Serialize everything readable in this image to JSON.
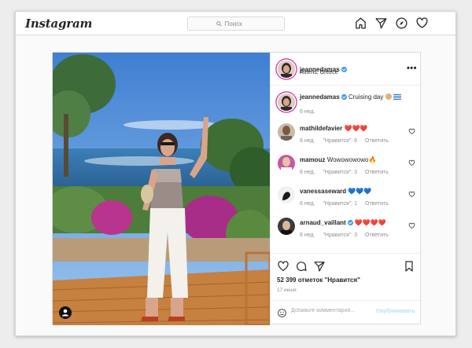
{
  "header": {
    "logo": "Instagram",
    "search_placeholder": "Поиск"
  },
  "post": {
    "author": "jeannedamas",
    "location": "Athens, Greece",
    "more": "•••",
    "caption": {
      "user": "jeannedamas",
      "text": "Cruising day",
      "time": "6 нед."
    },
    "comments": [
      {
        "user": "mathildefavier",
        "text": "❤️❤️❤️",
        "time": "6 нед.",
        "likes": "\"Нравится\": 6",
        "reply": "Ответить"
      },
      {
        "user": "mamouz",
        "text": "Wowowowowo🔥",
        "time": "6 нед.",
        "likes": "\"Нравится\": 3",
        "reply": "Ответить"
      },
      {
        "user": "vanessaseward",
        "text": "💙💙💙",
        "time": "6 нед.",
        "likes": "\"Нравится\": 1",
        "reply": "Ответить"
      },
      {
        "user": "arnaud_vaillant",
        "text": "❤️❤️❤️❤️",
        "time": "6 нед.",
        "likes": "\"Нравится\": 3",
        "reply": "Ответить"
      }
    ],
    "likes": "52 399 отметок \"Нравится\"",
    "date": "17 июня",
    "comment_placeholder": "Добавьте комментарий...",
    "publish": "Опубликовать"
  }
}
